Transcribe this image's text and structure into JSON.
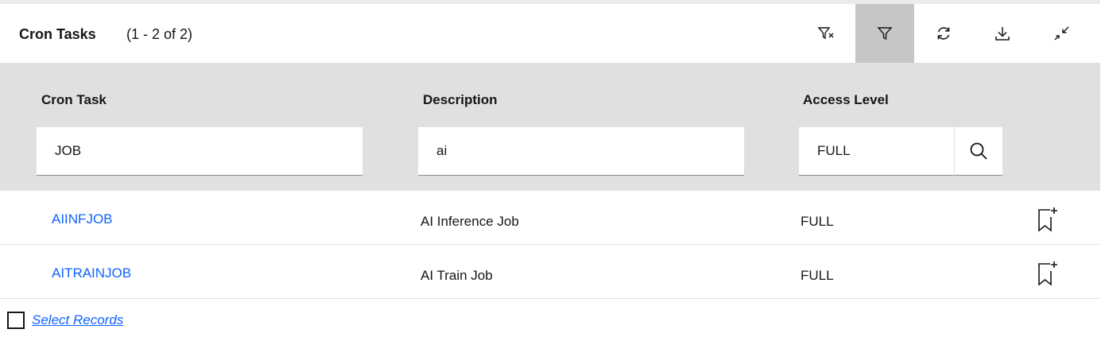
{
  "header": {
    "title": "Cron Tasks",
    "count": "(1 - 2 of 2)"
  },
  "toolbar": {
    "buttons": [
      {
        "icon": "clear-filter-icon",
        "active": false
      },
      {
        "icon": "filter-icon",
        "active": true
      },
      {
        "icon": "refresh-icon",
        "active": false
      },
      {
        "icon": "download-icon",
        "active": false
      },
      {
        "icon": "minimize-icon",
        "active": false
      }
    ]
  },
  "table": {
    "columns": [
      {
        "label": "Cron Task",
        "filter_value": "JOB"
      },
      {
        "label": "Description",
        "filter_value": "ai"
      },
      {
        "label": "Access Level",
        "filter_value": "FULL"
      }
    ],
    "rows": [
      {
        "cron_task": "AIINFJOB",
        "description": "AI Inference Job",
        "access_level": "FULL"
      },
      {
        "cron_task": "AITRAINJOB",
        "description": "AI Train Job",
        "access_level": "FULL"
      }
    ]
  },
  "footer": {
    "select_records_label": "Select Records"
  },
  "colors": {
    "link": "#0f62fe",
    "filter_bg": "#e0e0e0",
    "active_button": "#c6c6c6",
    "text": "#161616"
  }
}
